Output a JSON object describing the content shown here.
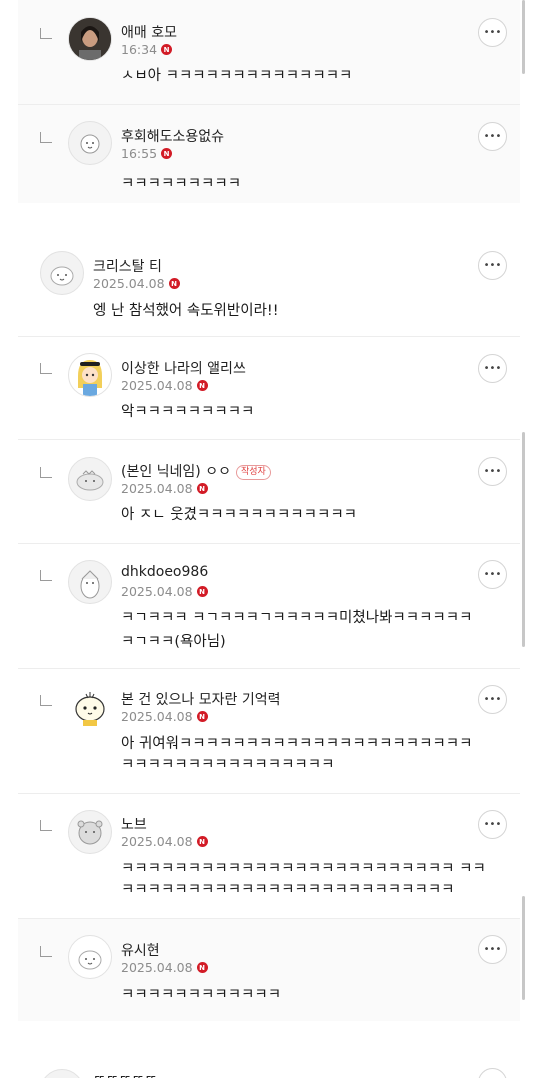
{
  "comments": [
    {
      "name": "애매 호모",
      "date": "16:34",
      "text": [
        "ㅅㅂ아 ㅋㅋㅋㅋㅋㅋㅋㅋㅋㅋㅋㅋㅋㅋ"
      ],
      "reply": true
    },
    {
      "name": "후회해도소용없슈",
      "date": "16:55",
      "text": [
        "ㅋㅋㅋㅋㅋㅋㅋㅋㅋ"
      ],
      "reply": true
    },
    {
      "name": "크리스탈 티",
      "date": "2025.04.08",
      "text": [
        "엥 난 참석했어 속도위반이라!!"
      ],
      "reply": false
    },
    {
      "name": "이상한 나라의 앨리쓰",
      "date": "2025.04.08",
      "text": [
        "악ㅋㅋㅋㅋㅋㅋㅋㅋㅋ"
      ],
      "reply": true
    },
    {
      "name": "(본인 닉네임) ㅇㅇ",
      "author_badge": "작성자",
      "date": "2025.04.08",
      "text": [
        "아 ㅈㄴ 웃겼ㅋㅋㅋㅋㅋㅋㅋㅋㅋㅋㅋㅋ"
      ],
      "reply": true
    },
    {
      "name": "dhkdoeo986",
      "date": "2025.04.08",
      "text": [
        "ㅋㄱㅋㅋㅋ ㅋㄱㅋㅋㅋㄱㅋㅋㅋㅋㅋ미쳤나봐ㅋㅋㅋㅋㅋㅋ",
        "ㅋㄱㅋㅋ(욕아님)"
      ],
      "reply": true
    },
    {
      "name": "본 건 있으나 모자란 기억력",
      "date": "2025.04.08",
      "text": [
        "아 귀여워ㅋㅋㅋㅋㅋㅋㅋㅋㅋㅋㅋㅋㅋㅋㅋㅋㅋㅋㅋㅋㅋㅋ",
        "ㅋㅋㅋㅋㅋㅋㅋㅋㅋㅋㅋㅋㅋㅋㅋㅋ"
      ],
      "reply": true
    },
    {
      "name": "노브",
      "date": "2025.04.08",
      "text": [
        "ㅋㅋㅋㅋㅋㅋㅋㅋㅋㅋㅋㅋㅋㅋㅋㅋㅋㅋㅋㅋㅋㅋㅋㅋㅋ ㅋㅋ",
        "ㅋㅋㅋㅋㅋㅋㅋㅋㅋㅋㅋㅋㅋㅋㅋㅋㅋㅋㅋㅋㅋㅋㅋㅋㅋ"
      ],
      "reply": true
    },
    {
      "name": "유시현",
      "date": "2025.04.08",
      "text": [
        "ㅋㅋㅋㅋㅋㅋㅋㅋㅋㅋㅋㅋ"
      ],
      "reply": true
    },
    {
      "name": "ㄸㄸㄸㄸㄸ",
      "date": "",
      "text": [],
      "reply": false
    }
  ],
  "icons": {
    "more": "more-dots-icon",
    "reply": "reply-arrow-icon",
    "new_badge": "N"
  },
  "colors": {
    "badge_red": "#d21b26",
    "author_badge": "#e04040",
    "meta": "#8c8c8c"
  }
}
